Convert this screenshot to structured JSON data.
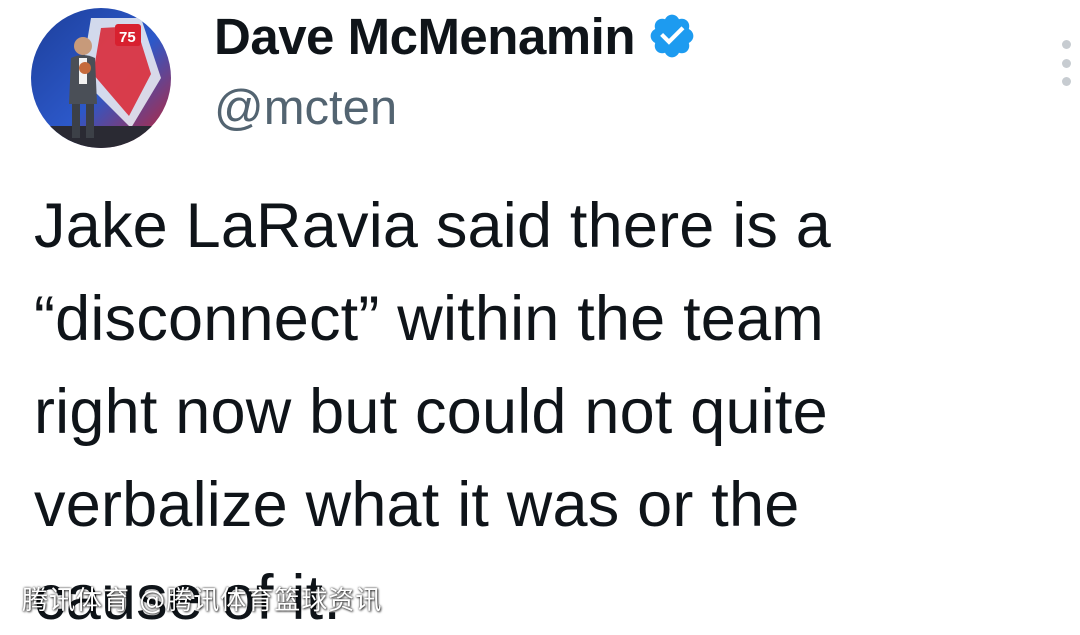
{
  "author": {
    "display_name": "Dave McMenamin",
    "handle": "@mcten",
    "verified": true,
    "avatar_icon": "profile-photo",
    "avatar_badge_text": "75"
  },
  "menu": {
    "icon": "more-vertical-icon"
  },
  "tweet": {
    "lines": [
      "Jake LaRavia said there is a",
      "“disconnect” within  the team",
      "right now but could not quite",
      "verbalize what it was or the",
      "cause of it."
    ]
  },
  "watermark": {
    "text": "腾讯体育 @腾讯体育篮球资讯"
  },
  "colors": {
    "text_primary": "#0f1419",
    "text_secondary": "#536471",
    "verified_blue": "#1d9bf0",
    "menu_dots": "#c7ccd1"
  }
}
